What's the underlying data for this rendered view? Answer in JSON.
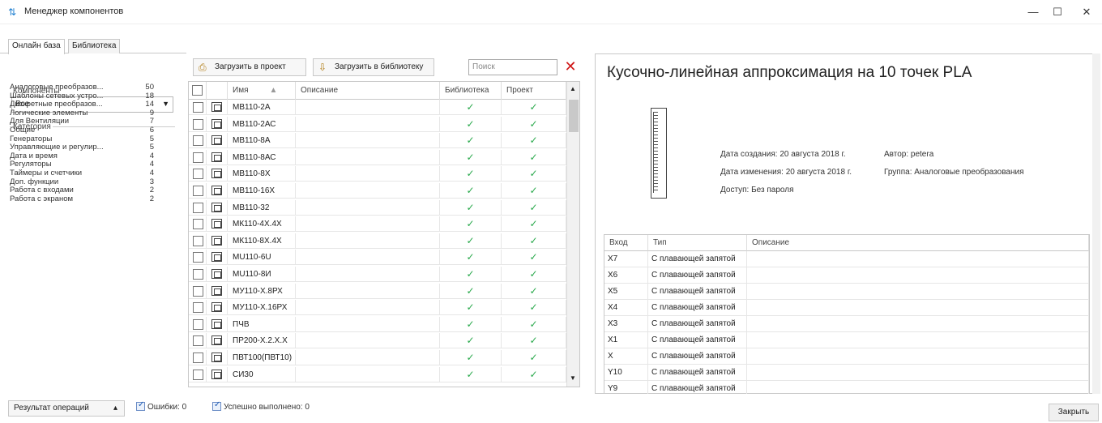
{
  "window": {
    "title": "Менеджер компонентов",
    "minimize": "—",
    "maximize": "☐",
    "close": "✕"
  },
  "tabs": [
    {
      "label": "Онлайн база"
    },
    {
      "label": "Библиотека"
    }
  ],
  "left": {
    "components_label": "Компоненты",
    "components_value": "Все",
    "category_label": "Категория",
    "categories": [
      {
        "name": "Аналоговые преобразов...",
        "count": "50"
      },
      {
        "name": "Шаблоны сетевых устро...",
        "count": "18"
      },
      {
        "name": "Дискретные преобразов...",
        "count": "14"
      },
      {
        "name": "Логические элементы",
        "count": "9"
      },
      {
        "name": "Для Вентиляции",
        "count": "7"
      },
      {
        "name": "Общие",
        "count": "6"
      },
      {
        "name": "Генераторы",
        "count": "5"
      },
      {
        "name": "Управляющие и регулир...",
        "count": "5"
      },
      {
        "name": "Дата и время",
        "count": "4"
      },
      {
        "name": "Регуляторы",
        "count": "4"
      },
      {
        "name": "Таймеры и счетчики",
        "count": "4"
      },
      {
        "name": "Доп. функции",
        "count": "3"
      },
      {
        "name": "Работа с входами",
        "count": "2"
      },
      {
        "name": "Работа с экраном",
        "count": "2"
      }
    ]
  },
  "toolbar": {
    "load_project": "Загрузить в проект",
    "load_library": "Загрузить в библиотеку",
    "search_placeholder": "Поиск"
  },
  "grid": {
    "headers": {
      "name": "Имя",
      "description": "Описание",
      "library": "Библиотека",
      "project": "Проект"
    },
    "check_glyph": "✓",
    "rows": [
      {
        "name": "МВ110-2А",
        "description": ""
      },
      {
        "name": "МВ110-2АС",
        "description": ""
      },
      {
        "name": "МВ110-8А",
        "description": ""
      },
      {
        "name": "МВ110-8АС",
        "description": ""
      },
      {
        "name": "МВ110-8Х",
        "description": ""
      },
      {
        "name": "МВ110-16Х",
        "description": ""
      },
      {
        "name": "МВ110-32",
        "description": ""
      },
      {
        "name": "МК110-4Х.4Х",
        "description": ""
      },
      {
        "name": "МК110-8Х.4Х",
        "description": ""
      },
      {
        "name": "МU110-6U",
        "description": ""
      },
      {
        "name": "МU110-8И",
        "description": ""
      },
      {
        "name": "МУ110-Х.8РХ",
        "description": ""
      },
      {
        "name": "МУ110-Х.16РХ",
        "description": ""
      },
      {
        "name": "ПЧВ",
        "description": ""
      },
      {
        "name": "ПР200-Х.2.Х.Х",
        "description": ""
      },
      {
        "name": "ПВТ100(ПВТ10)",
        "description": ""
      },
      {
        "name": "СИ30",
        "description": ""
      }
    ]
  },
  "detail": {
    "title": "Кусочно-линейная аппроксимация на 10 точек PLA",
    "created": "Дата создания: 20 августа 2018 г.",
    "modified": "Дата изменения: 20 августа 2018 г.",
    "access": "Доступ: Без пароля",
    "author": "Автор: petera",
    "group": "Группа: Аналоговые преобразования",
    "ports_headers": {
      "input": "Вход",
      "type": "Тип",
      "description": "Описание"
    },
    "ports": [
      {
        "input": "X7",
        "type": "С плавающей запятой"
      },
      {
        "input": "X6",
        "type": "С плавающей запятой"
      },
      {
        "input": "X5",
        "type": "С плавающей запятой"
      },
      {
        "input": "X4",
        "type": "С плавающей запятой"
      },
      {
        "input": "X3",
        "type": "С плавающей запятой"
      },
      {
        "input": "X1",
        "type": "С плавающей запятой"
      },
      {
        "input": "X",
        "type": "С плавающей запятой"
      },
      {
        "input": "Y10",
        "type": "С плавающей запятой"
      },
      {
        "input": "Y9",
        "type": "С плавающей запятой"
      }
    ]
  },
  "status": {
    "results_label": "Результат операций",
    "errors": "Ошибки: 0",
    "success": "Успешно выполнено: 0",
    "close_label": "Закрыть"
  }
}
